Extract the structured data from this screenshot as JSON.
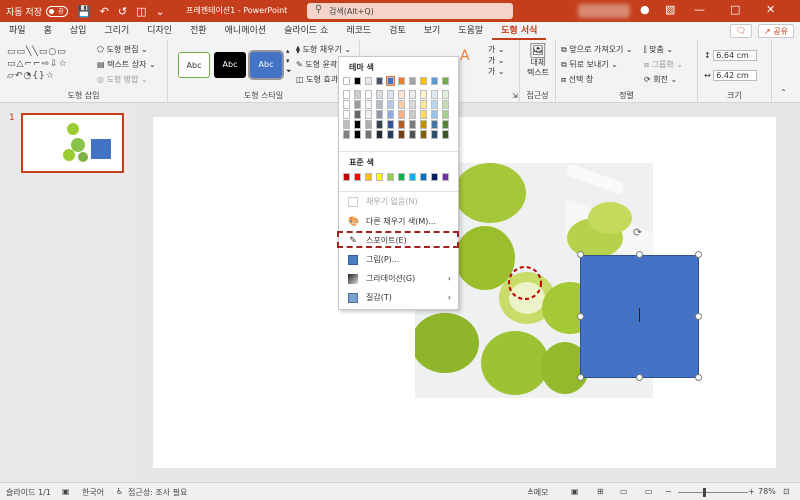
{
  "titlebar": {
    "autosave": "자동 저장",
    "toggle": "끔",
    "doc_title": "프레젠테이션1 - PowerPoint",
    "search_placeholder": "검색(Alt+Q)"
  },
  "tabs": [
    "파일",
    "홈",
    "삽입",
    "그리기",
    "디자인",
    "전환",
    "애니메이션",
    "슬라이드 쇼",
    "레코드",
    "검토",
    "보기",
    "도움말",
    "도형 서식"
  ],
  "tabs_right": {
    "share": "공유"
  },
  "ribbon": {
    "insert_shapes": {
      "label": "도형 삽입",
      "edit_shape": "도형 편집",
      "text_box": "텍스트 상자",
      "merge_shapes": "도형 병합"
    },
    "shape_styles": {
      "label": "도형 스타일",
      "style1": "Abc",
      "style2": "Abc",
      "style3": "Abc",
      "fill": "도형 채우기",
      "outline": "도형 윤곽선",
      "effects": "도형 효과"
    },
    "accessibility": {
      "label": "접근성",
      "alt_text": "대체 텍스트"
    },
    "arrange": {
      "label": "정렬",
      "bring_forward": "앞으로 가져오기",
      "send_backward": "뒤로 보내기",
      "selection_pane": "선택 창",
      "align": "맞춤",
      "group": "그룹화",
      "rotate": "회전"
    },
    "size": {
      "label": "크기",
      "height": "6.64 cm",
      "width": "6.42 cm"
    }
  },
  "slides": {
    "current_number": "1"
  },
  "fill_menu": {
    "theme_header": "테마 색",
    "standard_header": "표준 색",
    "no_fill": "채우기 없음(N)",
    "more_colors": "다른 채우기 색(M)...",
    "eyedropper": "스포이트(E)",
    "picture": "그림(P)...",
    "gradient": "그라데이션(G)",
    "texture": "질감(T)",
    "theme_colors": [
      "#ffffff",
      "#000000",
      "#e7e6e6",
      "#44546a",
      "#4472c4",
      "#ed7d31",
      "#a5a5a5",
      "#ffc000",
      "#5b9bd5",
      "#70ad47"
    ],
    "standard_colors": [
      "#c00000",
      "#ff0000",
      "#ffc000",
      "#ffff00",
      "#92d050",
      "#00b050",
      "#00b0f0",
      "#0070c0",
      "#002060",
      "#7030a0"
    ]
  },
  "status": {
    "slide": "슬라이드 1/1",
    "language": "한국어",
    "accessibility": "접근성: 조사 필요",
    "notes": "메모",
    "zoom": "78%"
  },
  "colors": {
    "accent": "#c43e1c",
    "shape_fill": "#4472c4"
  }
}
